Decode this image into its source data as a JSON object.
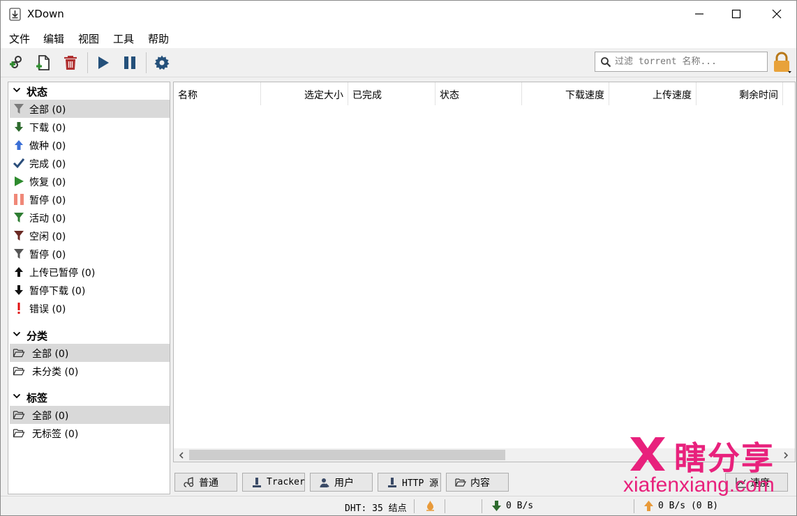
{
  "window": {
    "title": "XDown"
  },
  "menu": [
    "文件",
    "编辑",
    "视图",
    "工具",
    "帮助"
  ],
  "search": {
    "placeholder": "过滤 torrent 名称..."
  },
  "sidebar": {
    "status": {
      "title": "状态",
      "items": [
        {
          "label": "全部 (0)",
          "icon": "filter-icon",
          "selected": true
        },
        {
          "label": "下载 (0)",
          "icon": "download-arrow-icon"
        },
        {
          "label": "做种 (0)",
          "icon": "upload-arrow-icon"
        },
        {
          "label": "完成 (0)",
          "icon": "checkmark-icon"
        },
        {
          "label": "恢复 (0)",
          "icon": "play-icon"
        },
        {
          "label": "暂停 (0)",
          "icon": "pause-icon"
        },
        {
          "label": "活动 (0)",
          "icon": "active-filter-icon"
        },
        {
          "label": "空闲 (0)",
          "icon": "inactive-filter-icon"
        },
        {
          "label": "暂停 (0)",
          "icon": "stalled-filter-icon"
        },
        {
          "label": "上传已暂停 (0)",
          "icon": "upload-paused-icon"
        },
        {
          "label": "暂停下载 (0)",
          "icon": "download-paused-icon"
        },
        {
          "label": "错误 (0)",
          "icon": "error-icon"
        }
      ]
    },
    "categories": {
      "title": "分类",
      "items": [
        {
          "label": "全部 (0)",
          "selected": true
        },
        {
          "label": "未分类 (0)"
        }
      ]
    },
    "tags": {
      "title": "标签",
      "items": [
        {
          "label": "全部 (0)",
          "selected": true
        },
        {
          "label": "无标签 (0)"
        }
      ]
    }
  },
  "table": {
    "columns": [
      "名称",
      "选定大小",
      "已完成",
      "状态",
      "下载速度",
      "上传速度",
      "剩余时间"
    ]
  },
  "tabs": [
    "普通",
    "Tracker",
    "用户",
    "HTTP 源",
    "内容"
  ],
  "speed_tab": "速度",
  "status_bar": {
    "dht": "DHT: 35 结点",
    "download": "0 B/s",
    "upload": "0 B/s (0 B)"
  },
  "watermark": {
    "brand": "瞎分享",
    "url": "xiafenxiang.com"
  },
  "colors": {
    "watermark": "#e8217c",
    "download_green": "#2e7d32",
    "upload_blue": "#3b6fd6",
    "error_red": "#e01010"
  }
}
